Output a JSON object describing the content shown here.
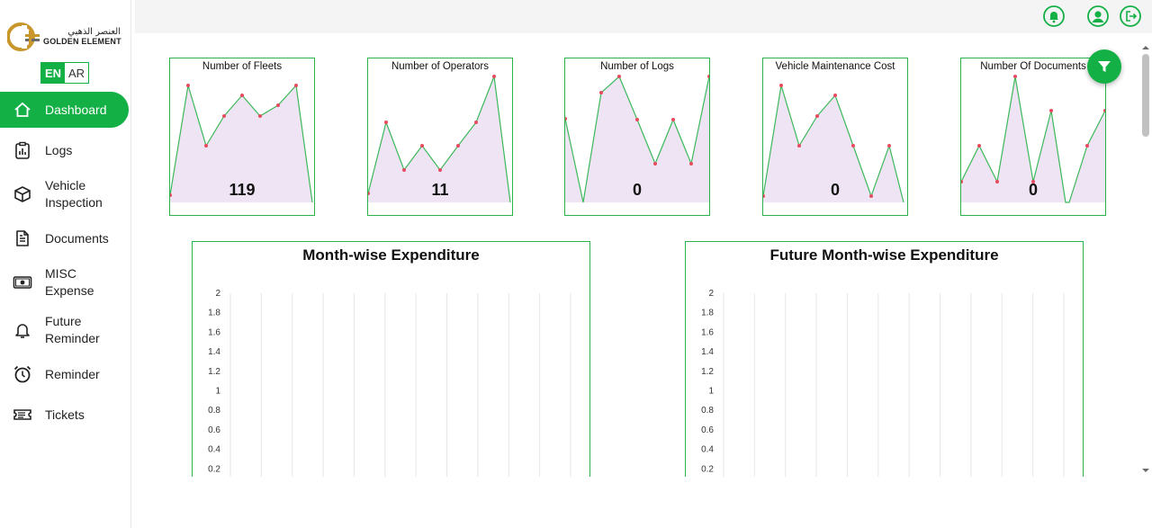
{
  "brand": {
    "arabic": "العنصر الذهبي",
    "english": "GOLDEN ELEMENT"
  },
  "language": {
    "en": "EN",
    "ar": "AR",
    "selected": "EN"
  },
  "sidebar": {
    "items": [
      {
        "label": "Dashboard",
        "icon": "home-icon",
        "active": true
      },
      {
        "label": "Logs",
        "icon": "clipboard-chart-icon"
      },
      {
        "label": "Vehicle Inspection",
        "icon": "cube-icon"
      },
      {
        "label": "Documents",
        "icon": "document-icon"
      },
      {
        "label": "MISC Expense",
        "icon": "cash-icon"
      },
      {
        "label": "Future Reminder",
        "icon": "bell-icon"
      },
      {
        "label": "Reminder",
        "icon": "alarm-clock-icon"
      },
      {
        "label": "Tickets",
        "icon": "ticket-icon"
      }
    ]
  },
  "topbar": {
    "icons": [
      "notification-bell-icon",
      "user-profile-icon",
      "logout-icon"
    ]
  },
  "colors": {
    "accent": "#13b045",
    "card_border": "#2bb24c",
    "sparkline_fill": "#efe4f4",
    "sparkline_line": "#3cb85a",
    "marker": "#e84a5f"
  },
  "cards": [
    {
      "title": "Number of Fleets",
      "value": "119"
    },
    {
      "title": "Number of Operators",
      "value": "11"
    },
    {
      "title": "Number of Logs",
      "value": "0"
    },
    {
      "title": "Vehicle Maintenance Cost",
      "value": "0"
    },
    {
      "title": "Number Of Documents",
      "value": "0"
    }
  ],
  "filter_button": {
    "icon": "filter-icon"
  },
  "chart_data": [
    {
      "type": "line",
      "title": "Month-wise Expenditure",
      "ylim": [
        0,
        2
      ],
      "yticks": [
        "2",
        "1.8",
        "1.6",
        "1.4",
        "1.2",
        "1",
        "0.8",
        "0.6",
        "0.4",
        "0.2"
      ],
      "grid": true,
      "series": []
    },
    {
      "type": "line",
      "title": "Future Month-wise Expenditure",
      "ylim": [
        0,
        2
      ],
      "yticks": [
        "2",
        "1.8",
        "1.6",
        "1.4",
        "1.2",
        "1",
        "0.8",
        "0.6",
        "0.4",
        "0.2"
      ],
      "grid": true,
      "series": []
    }
  ]
}
